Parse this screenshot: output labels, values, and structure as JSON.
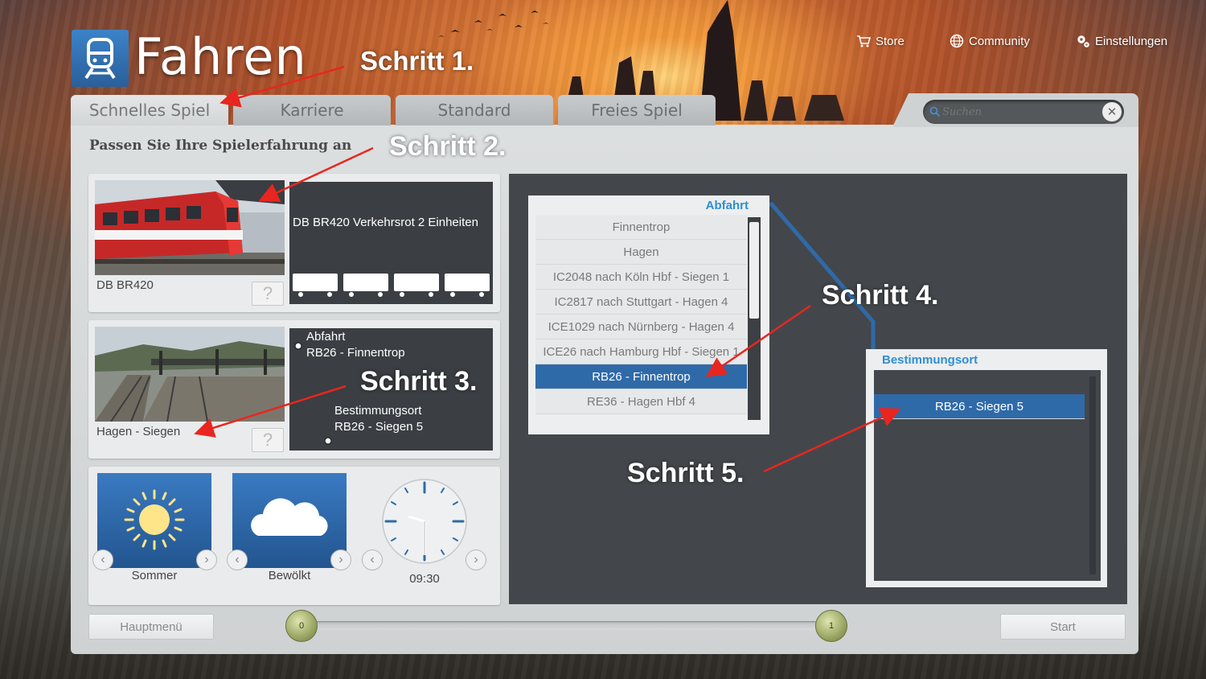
{
  "app": {
    "title": "Fahren",
    "logo_icon": "train-icon"
  },
  "topnav": {
    "store": "Store",
    "community": "Community",
    "settings": "Einstellungen"
  },
  "tabs": [
    {
      "label": "Schnelles Spiel",
      "active": true
    },
    {
      "label": "Karriere",
      "active": false
    },
    {
      "label": "Standard",
      "active": false
    },
    {
      "label": "Freies Spiel",
      "active": false
    }
  ],
  "search": {
    "placeholder": "Suchen"
  },
  "main": {
    "subtitle": "Passen Sie Ihre Spielerfahrung an"
  },
  "train_card": {
    "name": "DB BR420",
    "detail_title": "DB BR420 Verkehrsrot 2 Einheiten",
    "help_label": "?"
  },
  "route_card": {
    "name": "Hagen - Siegen",
    "departure_label": "Abfahrt",
    "departure_value": "RB26 - Finnentrop",
    "destination_label": "Bestimmungsort",
    "destination_value": "RB26 - Siegen 5",
    "help_label": "?"
  },
  "conditions": {
    "season": "Sommer",
    "weather": "Bewölkt",
    "time": "09:30"
  },
  "departure_list": {
    "title": "Abfahrt",
    "items": [
      {
        "label": "Finnentrop",
        "selected": false
      },
      {
        "label": "Hagen",
        "selected": false
      },
      {
        "label": "IC2048 nach Köln Hbf - Siegen 1",
        "selected": false
      },
      {
        "label": "IC2817 nach Stuttgart - Hagen 4",
        "selected": false
      },
      {
        "label": "ICE1029 nach Nürnberg - Hagen 4",
        "selected": false
      },
      {
        "label": "ICE26 nach Hamburg Hbf - Siegen 1",
        "selected": false
      },
      {
        "label": "RB26 - Finnentrop",
        "selected": true
      },
      {
        "label": "RE36 - Hagen Hbf 4",
        "selected": false
      }
    ]
  },
  "destination_list": {
    "title": "Bestimmungsort",
    "items": [
      {
        "label": "RB26 - Siegen 5",
        "selected": true
      }
    ]
  },
  "bottom": {
    "main_menu": "Hauptmenü",
    "start": "Start",
    "slider_min": "0",
    "slider_max": "1"
  },
  "annotations": {
    "step1": "Schritt 1.",
    "step2": "Schritt 2.",
    "step3": "Schritt 3.",
    "step4": "Schritt 4.",
    "step5": "Schritt 5."
  },
  "colors": {
    "accent_blue": "#2f6aa8",
    "title_blue": "#2f8fd2",
    "annotation_arrow": "#e8261f"
  }
}
